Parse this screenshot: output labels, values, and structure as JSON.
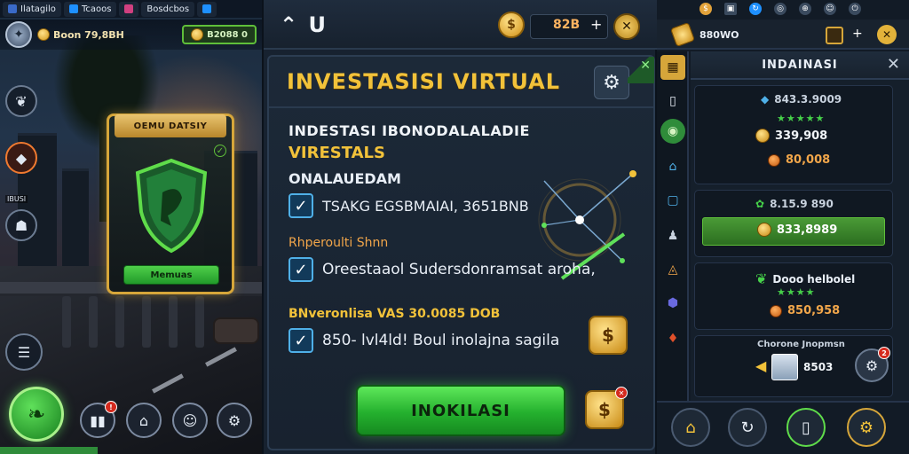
{
  "left": {
    "tabs": [
      {
        "label": "Ilatagilo",
        "color": "#3a6ac8"
      },
      {
        "label": "Tcaoos",
        "color": "#1e90ff"
      },
      {
        "label": "",
        "color": "#d04080"
      },
      {
        "label": "Bosdcbos",
        "color": "#2f8c3a"
      },
      {
        "label": "",
        "color": "#1e90ff"
      }
    ],
    "hud": {
      "coin_text": "Boon 79,8BH",
      "green_text": "B2088 0"
    },
    "shield_card": {
      "banner": "OEMU DATSIY",
      "button": "Memuas"
    },
    "side_label": "IBUSI"
  },
  "middle": {
    "topbar": {
      "logo": "⌃ U",
      "coin_value": "82B",
      "plus": "+"
    },
    "title": "INVESTASISI VIRTUAL",
    "headline": "INDESTASI IBONODALALADIE",
    "highlight": "VIRESTALS",
    "subhead": "ONALAUEDAM",
    "items": [
      {
        "checked": true,
        "text": "TSAKG EGSBMAIAI, 3651BNB"
      },
      {
        "checked": true,
        "text": "Oreestaaol Sudersdonramsat aroha,"
      },
      {
        "checked": true,
        "text": "850- lvl4ld! Boul inolajna sagila"
      }
    ],
    "section_label_1": "Rhperoulti Shnn",
    "section_label_2": "BNveronlisa VAS 30.0085 DOB",
    "cta": "INOKILASI"
  },
  "right": {
    "hud_value": "880WO",
    "title": "INDAINASI",
    "cards": [
      {
        "name": "843.3.9009",
        "value": "339,908",
        "reward": "80,008"
      },
      {
        "name": "8.15.9 890",
        "value": "833,8989",
        "reward": ""
      },
      {
        "name": "Dooo helbolel",
        "value": "",
        "reward": "850,958"
      },
      {
        "name": "Chorone Jnopmsn",
        "value": "8503",
        "reward": ""
      }
    ],
    "badge_count": "2"
  },
  "colors": {
    "gold": "#f2c23a",
    "green": "#24b02e",
    "panel": "#172230"
  }
}
